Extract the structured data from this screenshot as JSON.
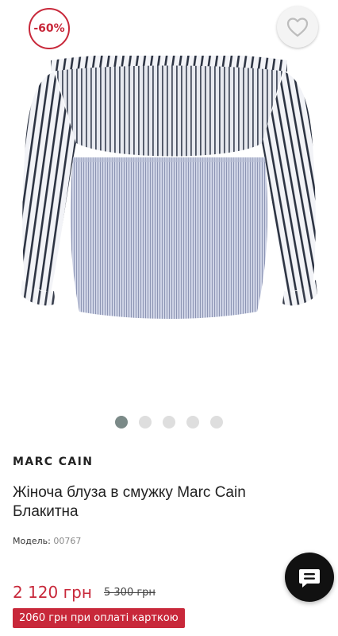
{
  "product": {
    "discount_badge": "-60%",
    "brand": "MARC CAIN",
    "title": "Жіноча блуза в смужку Marc Cain Блакитна",
    "model_label": "Модель:",
    "model_code": "00767",
    "price": "2 120 грн",
    "old_price": "5 300 грн",
    "card_offer": "2060 грн при оплаті карткою"
  },
  "gallery": {
    "image_count": 5,
    "active_index": 0
  },
  "icons": {
    "wishlist": "heart-icon",
    "chat": "chat-bubble-icon"
  },
  "colors": {
    "accent": "#c8283a",
    "dot_active": "#7b8a88",
    "dot_inactive": "#dedede",
    "chat_button": "#111111"
  }
}
